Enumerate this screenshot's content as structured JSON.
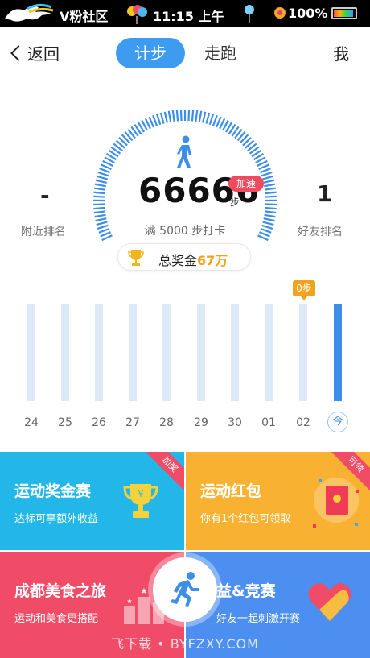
{
  "status_bar": {
    "carrier": "V粉社区",
    "time": "11:15 上午",
    "battery": "100%"
  },
  "header": {
    "back_label": "返回",
    "tabs": [
      {
        "label": "计步",
        "active": true
      },
      {
        "label": "走跑",
        "active": false
      }
    ],
    "me_label": "我"
  },
  "summary": {
    "steps": "66666",
    "steps_unit": "步",
    "speed_badge": "加速",
    "goal_text": "满 5000 步打卡",
    "nearby_rank_value": "-",
    "nearby_rank_label": "附近排名",
    "friend_rank_value": "1",
    "friend_rank_label": "好友排名",
    "prize_label": "总奖金",
    "prize_amount": "67万"
  },
  "history": {
    "tooltip": "0步",
    "days": [
      "24",
      "25",
      "26",
      "27",
      "28",
      "29",
      "30",
      "01",
      "02",
      "今"
    ],
    "active_index": 9
  },
  "cards": [
    {
      "title": "运动奖金赛",
      "subtitle": "达标可享额外收益",
      "corner": "加奖",
      "color": "#22b7e8"
    },
    {
      "title": "运动红包",
      "subtitle": "你有1个红包可领取",
      "corner": "可领",
      "color": "#f9b131"
    },
    {
      "title": "成都美食之旅",
      "subtitle": "运动和美食更搭配",
      "corner": "",
      "color": "#f04b67"
    },
    {
      "title": "益&竞赛",
      "subtitle": "好友一起刺激开赛",
      "corner": "",
      "color": "#4d8ff0"
    }
  ],
  "watermark": "飞下载 • BYFZXY.COM",
  "colors": {
    "accent": "#3d9cf0",
    "gold": "#f2a31b",
    "badge_red": "#ef4a5e"
  },
  "icons": [
    "back-chevron-icon",
    "walker-icon",
    "trophy-icon",
    "red-packet-icon",
    "heart-icon",
    "runner-icon"
  ]
}
